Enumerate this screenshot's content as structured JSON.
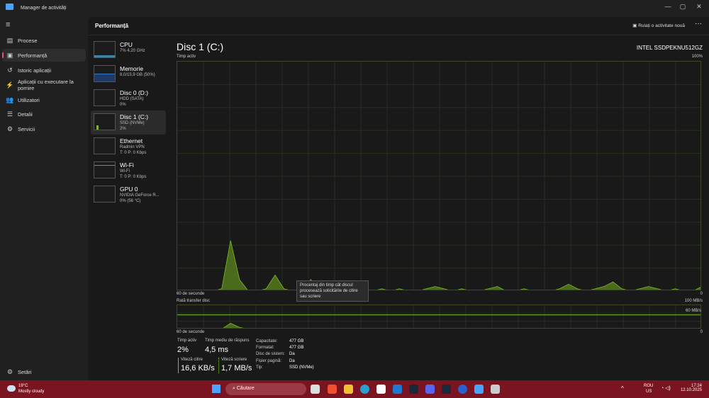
{
  "window": {
    "title": "Manager de activități",
    "minimize": "—",
    "maximize": "▢",
    "close": "✕"
  },
  "nav": {
    "items": [
      {
        "label": "Procese",
        "icon": "processes-icon",
        "glyph": "▤"
      },
      {
        "label": "Performanță",
        "icon": "performance-icon",
        "glyph": "▣"
      },
      {
        "label": "Istoric aplicații",
        "icon": "history-icon",
        "glyph": "↺"
      },
      {
        "label": "Aplicații cu executare la pornire",
        "icon": "startup-icon",
        "glyph": "⚡"
      },
      {
        "label": "Utilizatori",
        "icon": "users-icon",
        "glyph": "👥"
      },
      {
        "label": "Detalii",
        "icon": "details-icon",
        "glyph": "☰"
      },
      {
        "label": "Servicii",
        "icon": "services-icon",
        "glyph": "⚙"
      }
    ],
    "settings": "Setări",
    "settings_glyph": "⚙",
    "menu_glyph": "≡"
  },
  "header": {
    "title": "Performanță",
    "run_new": "Rulați o activitate nouă",
    "more": "···"
  },
  "devices": [
    {
      "name": "CPU",
      "line1": "7% 4,20 GHz",
      "line2": "",
      "color": "#4ab0e8"
    },
    {
      "name": "Memorie",
      "line1": "8,0/15,9 GB (50%)",
      "line2": "",
      "color": "#3a78c8"
    },
    {
      "name": "Disc 0 (D:)",
      "line1": "HDD (SATA)",
      "line2": "0%",
      "color": "#7fb82e"
    },
    {
      "name": "Disc 1 (C:)",
      "line1": "SSD (NVMe)",
      "line2": "2%",
      "color": "#7fb82e"
    },
    {
      "name": "Ethernet",
      "line1": "Radmin VPN",
      "line2": "T: 0 P: 0 Kbps",
      "color": "#c05a9a"
    },
    {
      "name": "Wi-Fi",
      "line1": "Wi-Fi",
      "line2": "T: 0 P: 0 Kbps",
      "color": "#c05a9a"
    },
    {
      "name": "GPU 0",
      "line1": "NVIDIA GeForce R...",
      "line2": "0% (56 °C)",
      "color": "#c05a9a"
    }
  ],
  "main": {
    "title": "Disc 1 (C:)",
    "model": "INTEL SSDPEKNU512GZ",
    "active_label": "Timp activ",
    "active_max": "100%",
    "sixty": "60 de secunde",
    "zero": "0",
    "transfer_label": "Rată transfer disc",
    "transfer_max": "100 MB/s",
    "transfer_mid": "60 MB/s",
    "tooltip": "Procentaj din timp cât discul procesează solicitările de citire sau scriere"
  },
  "stats": {
    "active_label": "Timp activ",
    "active": "2%",
    "resp_label": "Timp mediu de răspuns",
    "resp": "4,5 ms",
    "read_label": "Viteză citire",
    "read": "16,6 KB/s",
    "write_label": "Viteză scriere",
    "write": "1,7 MB/s"
  },
  "props": [
    {
      "k": "Capacitate:",
      "v": "477 GB"
    },
    {
      "k": "Formatat:",
      "v": "477 GB"
    },
    {
      "k": "Disc de sistem:",
      "v": "Da"
    },
    {
      "k": "Fișier paginå:",
      "v": "Da"
    },
    {
      "k": "Tip:",
      "v": "SSD (NVMe)"
    }
  ],
  "chart_data": {
    "type": "area",
    "title": "Timp activ",
    "ylim": [
      0,
      100
    ],
    "xlim": [
      60,
      0
    ],
    "values": [
      0,
      0,
      0,
      0,
      0,
      1,
      22,
      5,
      0,
      0,
      1,
      7,
      1,
      0,
      0,
      5,
      2,
      1,
      0,
      1,
      0,
      1,
      0,
      1,
      0,
      1,
      0,
      0,
      1,
      2,
      1,
      0,
      1,
      0,
      0,
      1,
      2,
      0,
      0,
      1,
      0,
      0,
      0,
      1,
      3,
      1,
      0,
      1,
      2,
      4,
      1,
      0,
      1,
      2,
      1,
      0,
      1,
      0,
      0,
      2
    ],
    "transfer": [
      0,
      0,
      0,
      0,
      0,
      1,
      25,
      8,
      1,
      0,
      0,
      4,
      0,
      0,
      0,
      3,
      1,
      0,
      0,
      1,
      0,
      0,
      0,
      1,
      0,
      0,
      0,
      0,
      1,
      1,
      0,
      0,
      1,
      0,
      0,
      0,
      1,
      0,
      0,
      1,
      0,
      0,
      0,
      1,
      2,
      0,
      0,
      1,
      1,
      2,
      1,
      0,
      1,
      1,
      0,
      0,
      1,
      0,
      0,
      1
    ]
  },
  "taskbar": {
    "temp": "19°C",
    "weather": "Mostly cloudy",
    "search": "Căutare",
    "lang1": "ROU",
    "lang2": "US",
    "time": "17:24",
    "date": "12.10.2025"
  }
}
